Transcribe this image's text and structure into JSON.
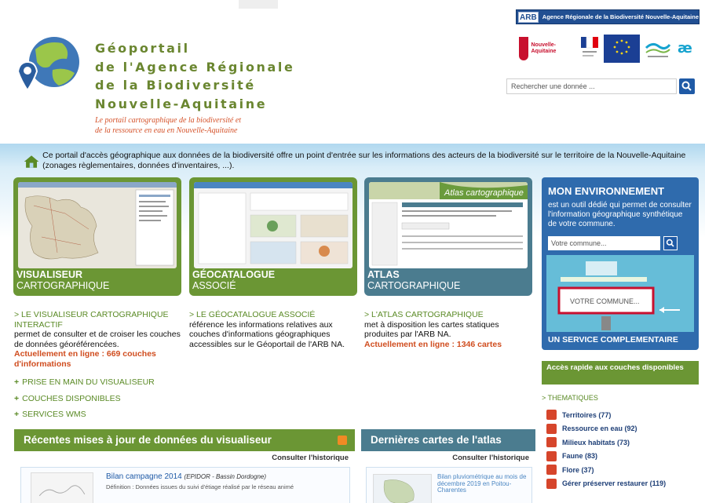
{
  "header": {
    "title_lines": [
      "Géoportail",
      "de l'Agence Régionale",
      "de la Biodiversité",
      "Nouvelle-Aquitaine"
    ],
    "subtitle_lines": [
      "Le portail cartographique de la biodiversité et",
      "de la ressource en eau en Nouvelle-Aquitaine"
    ],
    "arb_logo": "ARB",
    "arb_banner": "Agence Régionale de la Biodiversité Nouvelle-Aquitaine",
    "partner_na": "Nouvelle-Aquitaine",
    "search_placeholder": "Rechercher une donnée ..."
  },
  "intro": {
    "text": "Ce portail d'accès géographique aux données de la biodiversité offre un point d'entrée sur les informations des acteurs de la biodiversité sur le territoire de la Nouvelle-Aquitaine (zonages règlementaires, données d'inventaires, ...)."
  },
  "tiles": [
    {
      "title": "VISUALISEUR",
      "subtitle": "CARTOGRAPHIQUE"
    },
    {
      "title": "GÉOCATALOGUE",
      "subtitle": "ASSOCIÉ"
    },
    {
      "title": "ATLAS",
      "subtitle": "CARTOGRAPHIQUE",
      "banner": "Atlas cartographique"
    }
  ],
  "columns": [
    {
      "link": "> LE VISUALISEUR CARTOGRAPHIQUE INTERACTIF",
      "desc": "permet de consulter et de croiser les couches de données géoréférencées.",
      "highlight": "Actuellement en ligne : 669 couches d'informations"
    },
    {
      "link": "> LE GÉOCATALOGUE ASSOCIÉ",
      "desc": "référence les informations relatives aux couches d'informations géographiques accessibles sur le Géoportail de l'ARB NA.",
      "highlight": ""
    },
    {
      "link": "> L'ATLAS CARTOGRAPHIQUE",
      "desc": "met à disposition les cartes statiques produites par l'ARB NA.",
      "highlight": "Actuellement en ligne : 1346 cartes"
    }
  ],
  "plus_links": [
    "PRISE EN MAIN DU VISUALISEUR",
    "COUCHES DISPONIBLES",
    "SERVICES WMS"
  ],
  "environment": {
    "title": "MON ENVIRONNEMENT",
    "desc": "est un outil dédié qui permet de consulter l'information géographique synthétique de votre commune.",
    "input_placeholder": "Votre commune...",
    "visual_button": "VOTRE COMMUNE...",
    "footer": "UN SERVICE COMPLEMENTAIRE"
  },
  "quick_access": {
    "title": "Accès rapide aux couches disponibles",
    "category": "> THEMATIQUES",
    "items": [
      "Territoires (77)",
      "Ressource en eau (92)",
      "Milieux habitats (73)",
      "Faune (83)",
      "Flore (37)",
      "Gérer préserver restaurer (119)"
    ]
  },
  "recent": {
    "title": "Récentes mises à jour de données du visualiseur",
    "consult": "Consulter l'historique",
    "item_title": "Bilan campagne 2014",
    "item_source": "(EPIDOR - Bassin Dordogne)",
    "item_desc": "Définition : Données issues du suivi d'étiage réalisé par le réseau animé"
  },
  "atlas_news": {
    "title": "Dernières cartes de l'atlas",
    "consult": "Consulter l'historique",
    "item_title": "Bilan pluviométrique au mois de décembre 2019 en Poitou-Charentes"
  },
  "colors": {
    "green": "#6b9634",
    "blue": "#2f6bad",
    "orange": "#d04d1f",
    "teal": "#4b7c8f"
  }
}
